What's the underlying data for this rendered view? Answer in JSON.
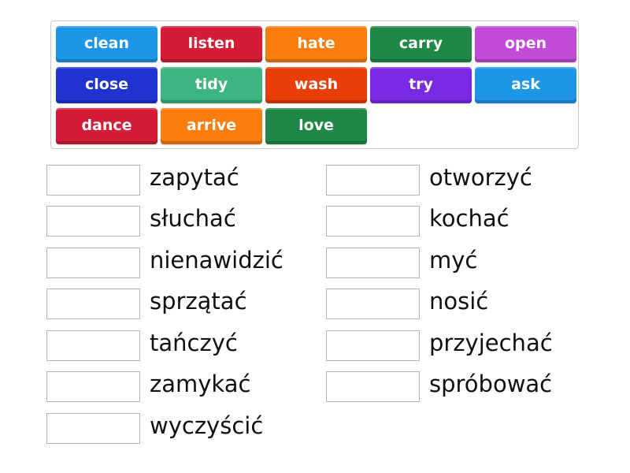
{
  "tiles": [
    {
      "label": "clean",
      "color": "#1e96e8"
    },
    {
      "label": "listen",
      "color": "#d41c36"
    },
    {
      "label": "hate",
      "color": "#fb7d0d"
    },
    {
      "label": "carry",
      "color": "#1f8847"
    },
    {
      "label": "open",
      "color": "#c24ad8"
    },
    {
      "label": "close",
      "color": "#1f33d0"
    },
    {
      "label": "tidy",
      "color": "#3cb581"
    },
    {
      "label": "wash",
      "color": "#ea3e0a"
    },
    {
      "label": "try",
      "color": "#7a2ae4"
    },
    {
      "label": "ask",
      "color": "#1e96e8"
    },
    {
      "label": "dance",
      "color": "#d41c36"
    },
    {
      "label": "arrive",
      "color": "#fb7d0d"
    },
    {
      "label": "love",
      "color": "#1f8847"
    }
  ],
  "targets_left": [
    {
      "label": "zapytać"
    },
    {
      "label": "słuchać"
    },
    {
      "label": "nienawidzić"
    },
    {
      "label": "sprzątać"
    },
    {
      "label": "tańczyć"
    },
    {
      "label": "zamykać"
    },
    {
      "label": "wyczyścić"
    }
  ],
  "targets_right": [
    {
      "label": "otworzyć"
    },
    {
      "label": "kochać"
    },
    {
      "label": "myć"
    },
    {
      "label": "nosić"
    },
    {
      "label": "przyjechać"
    },
    {
      "label": "spróbować"
    }
  ]
}
